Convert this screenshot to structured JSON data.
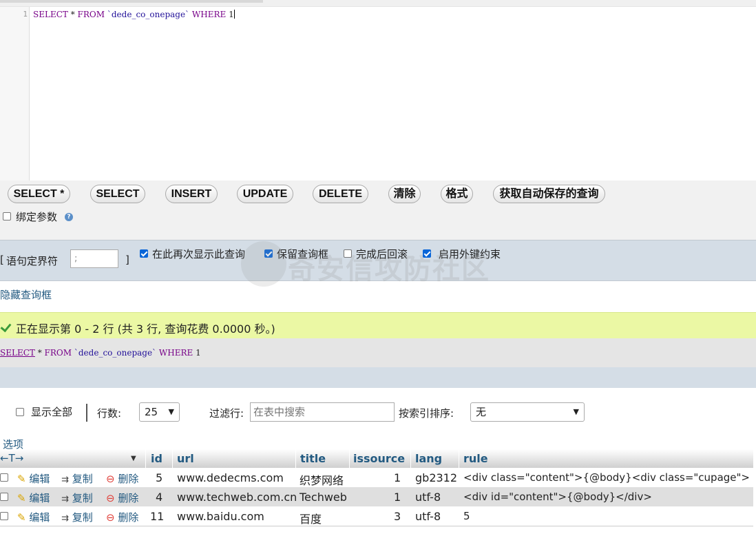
{
  "editor": {
    "line_number": "1",
    "tokens": [
      "SELECT",
      " * ",
      "FROM",
      " ",
      "`dede_co_onepage`",
      " ",
      "WHERE",
      " 1"
    ]
  },
  "buttons": [
    "SELECT *",
    "SELECT",
    "INSERT",
    "UPDATE",
    "DELETE",
    "清除",
    "格式",
    "获取自动保存的查询"
  ],
  "bind_params": {
    "label": "绑定参数",
    "help_icon": "help-icon",
    "checked": false
  },
  "delimiter": {
    "open_bracket": "[",
    "label": "语句定界符",
    "value": ";",
    "close_bracket": "]",
    "options": [
      {
        "label": "在此再次显示此查询",
        "checked": true
      },
      {
        "label": "保留查询框",
        "checked": true
      },
      {
        "label": "完成后回滚",
        "checked": false
      },
      {
        "label": "启用外键约束",
        "checked": true
      }
    ]
  },
  "watermark": "奇安信攻防社区",
  "hide_query_link": "隐藏查询框",
  "success_message": "正在显示第 0 - 2 行 (共 3 行, 查询花费 0.0000 秒。)",
  "sql_echo": {
    "tokens": [
      "SELECT",
      " * ",
      "FROM",
      " ",
      "`dede_co_onepage`",
      " ",
      "WHERE",
      " 1"
    ]
  },
  "controls": {
    "show_all": {
      "label": "显示全部",
      "checked": false
    },
    "rows_label": "行数:",
    "rows_value": "25",
    "filter_label": "过滤行:",
    "filter_placeholder": "在表中搜索",
    "sort_label": "按索引排序:",
    "sort_value": "无"
  },
  "options_link": "选项",
  "table": {
    "arrows": "←T→",
    "columns": [
      "id",
      "url",
      "title",
      "issource",
      "lang",
      "rule"
    ],
    "actions": {
      "edit": "编辑",
      "copy": "复制",
      "delete": "删除"
    },
    "rows": [
      {
        "id": "5",
        "url": "www.dedecms.com",
        "title": "织梦网络",
        "issource": "1",
        "lang": "gb2312",
        "rule": "<div class=\"content\">{@body}<div class=\"cupage\">"
      },
      {
        "id": "4",
        "url": "www.techweb.com.cn",
        "title": "Techweb",
        "issource": "1",
        "lang": "utf-8",
        "rule": "<div id=\"content\">{@body}</div>"
      },
      {
        "id": "11",
        "url": "www.baidu.com",
        "title": "百度",
        "issource": "3",
        "lang": "utf-8",
        "rule": "5"
      }
    ]
  },
  "colors": {
    "link": "#235a81",
    "success_bg": "#ebf8a4",
    "bar_bg": "#d4dde6",
    "keyword": "#770088",
    "string": "#221199"
  }
}
